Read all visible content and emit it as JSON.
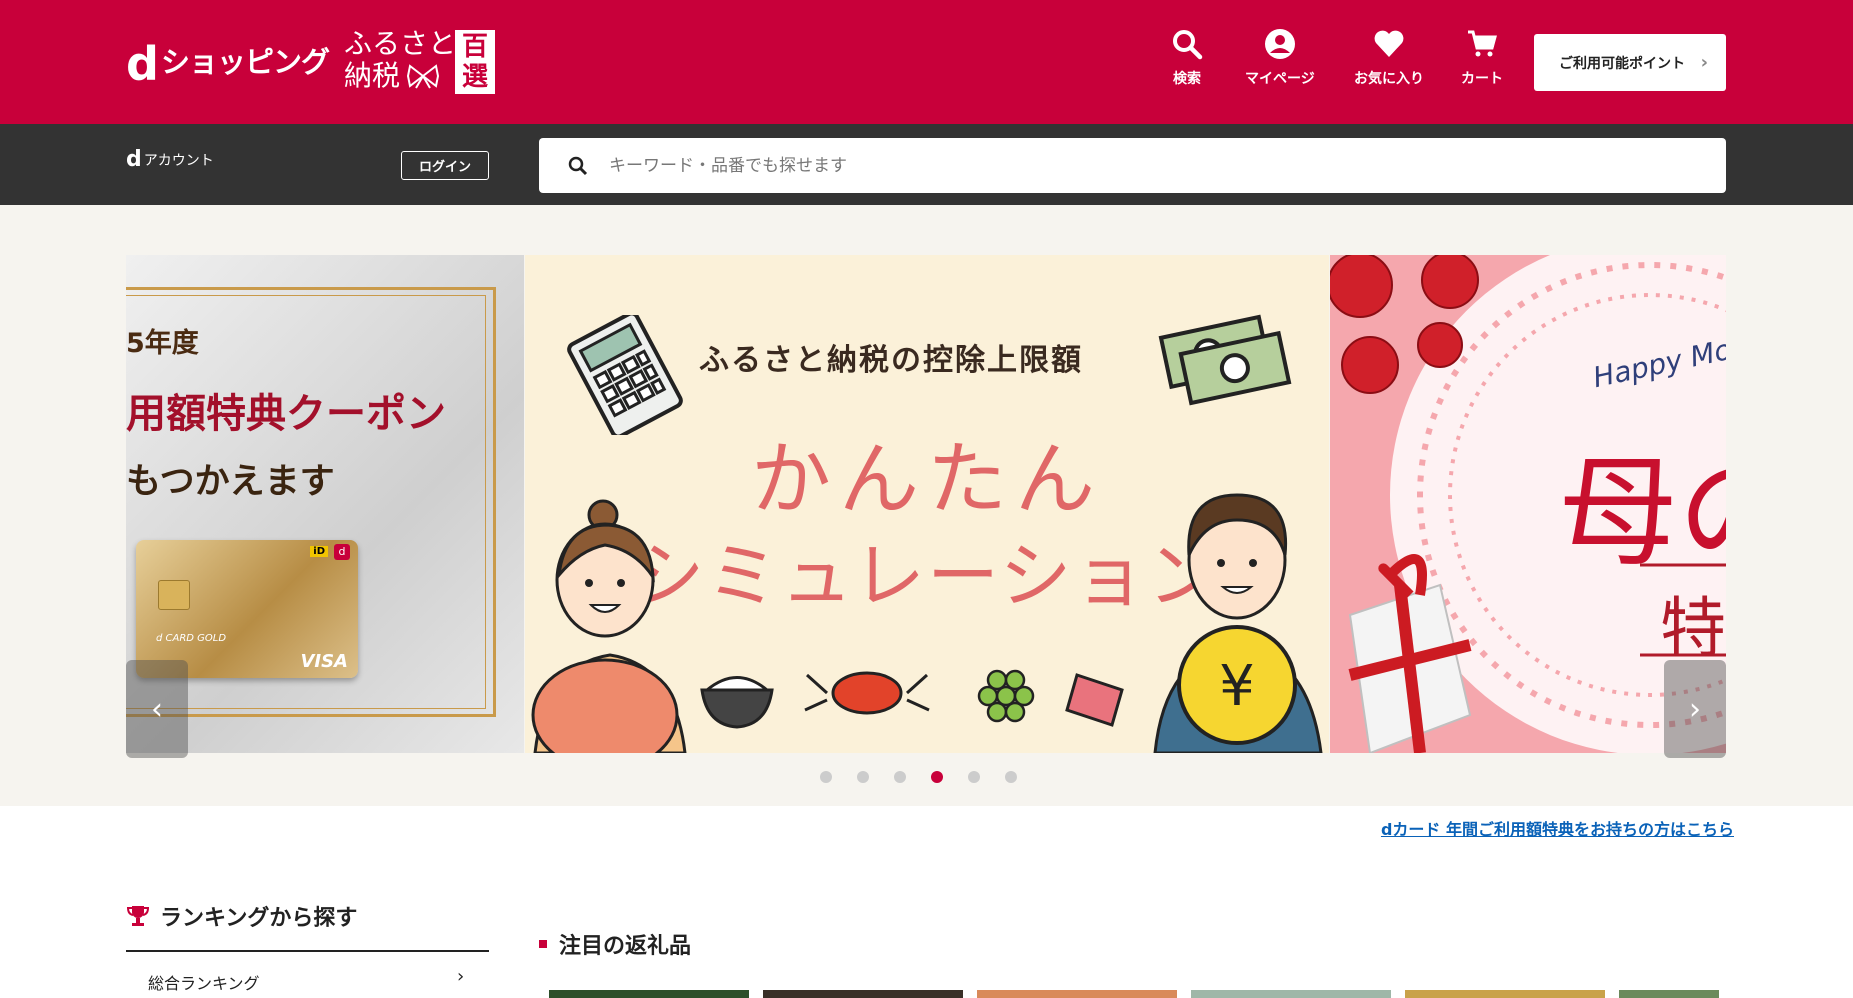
{
  "header": {
    "logo_d": "d",
    "logo_text": "ショッピング",
    "furusato_line1": "ふるさと",
    "furusato_line2": "納税",
    "hyakusen_1": "百",
    "hyakusen_2": "選",
    "nav": [
      {
        "label": "検索",
        "icon": "search-icon"
      },
      {
        "label": "マイページ",
        "icon": "user-circle-icon"
      },
      {
        "label": "お気に入り",
        "icon": "heart-icon"
      },
      {
        "label": "カート",
        "icon": "cart-icon"
      }
    ],
    "points_button": "ご利用可能ポイント",
    "brand_color": "#c8003a"
  },
  "subbar": {
    "account_d": "d",
    "account_label": "アカウント",
    "login_label": "ログイン",
    "search_placeholder": "キーワード・品番でも探せます"
  },
  "carousel": {
    "left_slide": {
      "year_text": "5年度",
      "coupon_text": "用額特典クーポン",
      "usable_text": "もつかえます",
      "card_brand": "d CARD GOLD",
      "card_visa": "VISA",
      "card_id": "iD",
      "card_d": "d"
    },
    "center_slide": {
      "top_text": "ふるさと納税の控除上限額",
      "big_text": "かんたん",
      "sim_text": "シミュレーション"
    },
    "right_slide": {
      "happy_text": "Happy Mo",
      "big_char": "母の",
      "tokuchar": "特"
    },
    "dots_count": 6,
    "active_dot": 4
  },
  "dcard_link": "dカード 年間ご利用額特典をお持ちの方はこちら",
  "ranking": {
    "title": "ランキングから探す",
    "items": [
      {
        "label": "総合ランキング"
      }
    ]
  },
  "featured": {
    "title": "注目の返礼品"
  }
}
